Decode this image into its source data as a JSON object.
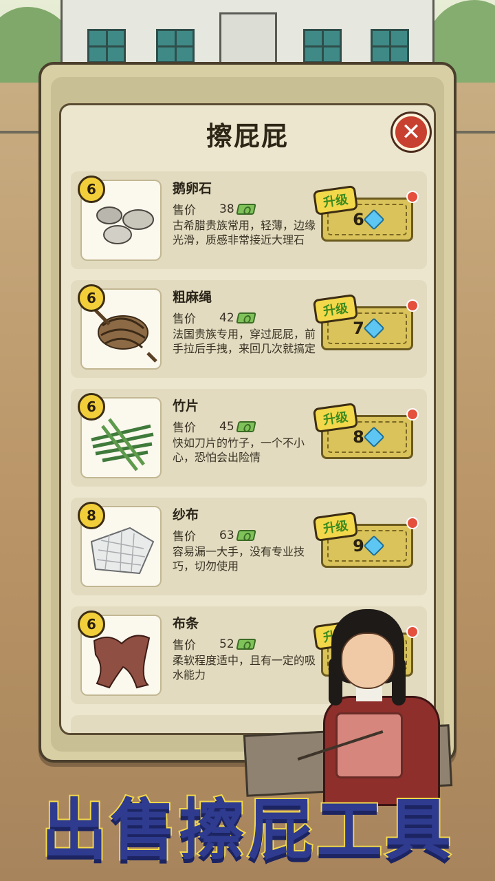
{
  "panel": {
    "title": "擦屁屁",
    "close_icon": "close-icon"
  },
  "items": [
    {
      "level": "6",
      "name": "鹅卵石",
      "price_label": "售价",
      "price": "38",
      "description": "古希腊贵族常用，轻薄，边缘光滑，质感非常接近大理石",
      "upgrade_label": "升级",
      "upgrade_cost": "6",
      "icon": "pebbles"
    },
    {
      "level": "6",
      "name": "粗麻绳",
      "price_label": "售价",
      "price": "42",
      "description": "法国贵族专用，穿过屁屁，前手拉后手拽，来回几次就搞定",
      "upgrade_label": "升级",
      "upgrade_cost": "7",
      "icon": "rope"
    },
    {
      "level": "6",
      "name": "竹片",
      "price_label": "售价",
      "price": "45",
      "description": "快如刀片的竹子，一个不小心，恐怕会出险情",
      "upgrade_label": "升级",
      "upgrade_cost": "8",
      "icon": "bamboo-strips"
    },
    {
      "level": "8",
      "name": "纱布",
      "price_label": "售价",
      "price": "63",
      "description": "容易漏一大手，没有专业技巧，切勿使用",
      "upgrade_label": "升级",
      "upgrade_cost": "9",
      "icon": "gauze"
    },
    {
      "level": "6",
      "name": "布条",
      "price_label": "售价",
      "price": "52",
      "description": "柔软程度适中，且有一定的吸水能力",
      "upgrade_label": "升级",
      "upgrade_cost": "",
      "icon": "cloth-strips"
    }
  ],
  "caption": "出售擦屁工具",
  "colors": {
    "caption_fill": "#2e3b8f",
    "caption_stroke": "#f2d84a",
    "level_badge": "#f2cf3a",
    "upgrade_button": "#d9c35a",
    "close_button": "#c8402f"
  }
}
